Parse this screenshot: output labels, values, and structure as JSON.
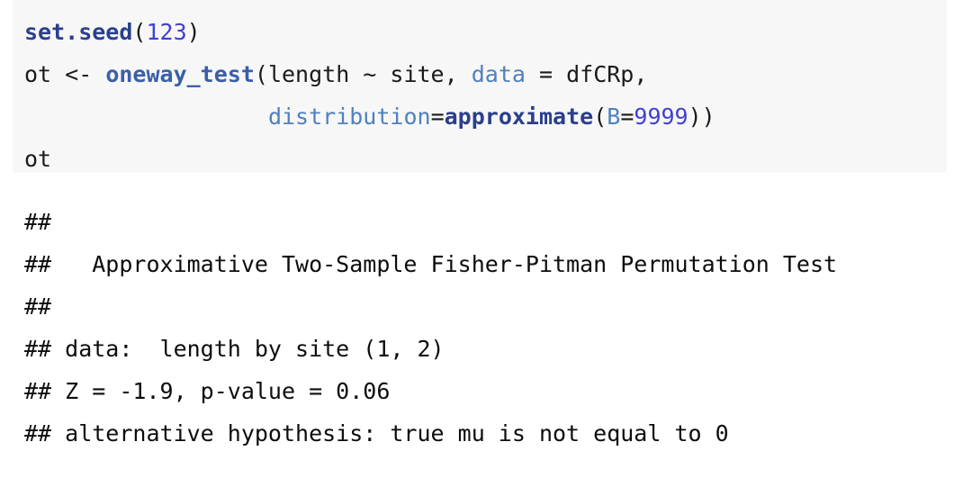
{
  "code_chunk": {
    "background_color": "#f7f7f7",
    "language": "r",
    "lines": [
      {
        "id": "line-set-seed",
        "text": "set.seed(123)",
        "tokens": [
          {
            "t": "set.seed",
            "k": "fn"
          },
          {
            "t": "(",
            "k": "plain"
          },
          {
            "t": "123",
            "k": "num"
          },
          {
            "t": ")",
            "k": "plain"
          }
        ]
      },
      {
        "id": "line-oneway-test",
        "text": "ot <- oneway_test(length ~ site, data = dfCRp,",
        "tokens": [
          {
            "t": "ot <- ",
            "k": "plain"
          },
          {
            "t": "oneway_test",
            "k": "fn2"
          },
          {
            "t": "(length ~ site, ",
            "k": "plain"
          },
          {
            "t": "data",
            "k": "arg"
          },
          {
            "t": " = dfCRp,",
            "k": "plain"
          }
        ]
      },
      {
        "id": "line-distribution",
        "text": "                  distribution=approximate(B=9999))",
        "tokens": [
          {
            "t": "                  ",
            "k": "plain"
          },
          {
            "t": "distribution",
            "k": "arg"
          },
          {
            "t": "=",
            "k": "plain"
          },
          {
            "t": "approximate",
            "k": "fn"
          },
          {
            "t": "(",
            "k": "plain"
          },
          {
            "t": "B",
            "k": "arg"
          },
          {
            "t": "=",
            "k": "plain"
          },
          {
            "t": "9999",
            "k": "num"
          },
          {
            "t": "))",
            "k": "plain"
          }
        ]
      },
      {
        "id": "line-ot",
        "text": "ot",
        "tokens": [
          {
            "t": "ot",
            "k": "plain"
          }
        ]
      }
    ]
  },
  "console_output": {
    "comment_prefix": "##",
    "lines": [
      "## ",
      "##   Approximative Two-Sample Fisher-Pitman Permutation Test",
      "## ",
      "## data:  length by site (1, 2)",
      "## Z = -1.9, p-value = 0.06",
      "## alternative hypothesis: true mu is not equal to 0"
    ],
    "results": {
      "test_name": "Approximative Two-Sample Fisher-Pitman Permutation Test",
      "data_description": "length by site (1, 2)",
      "Z": "-1.9",
      "p_value": "0.06",
      "alternative_hypothesis": "true mu is not equal to 0"
    }
  },
  "colors": {
    "code_background": "#f7f7f7",
    "page_background": "#ffffff",
    "function_name": "#2b3f8c",
    "function_name_alt": "#3a5fa8",
    "number_literal": "#4040d0",
    "argument_name": "#4f81bd",
    "plain_text": "#1a1a1a",
    "output_text": "#0d0d0d"
  }
}
